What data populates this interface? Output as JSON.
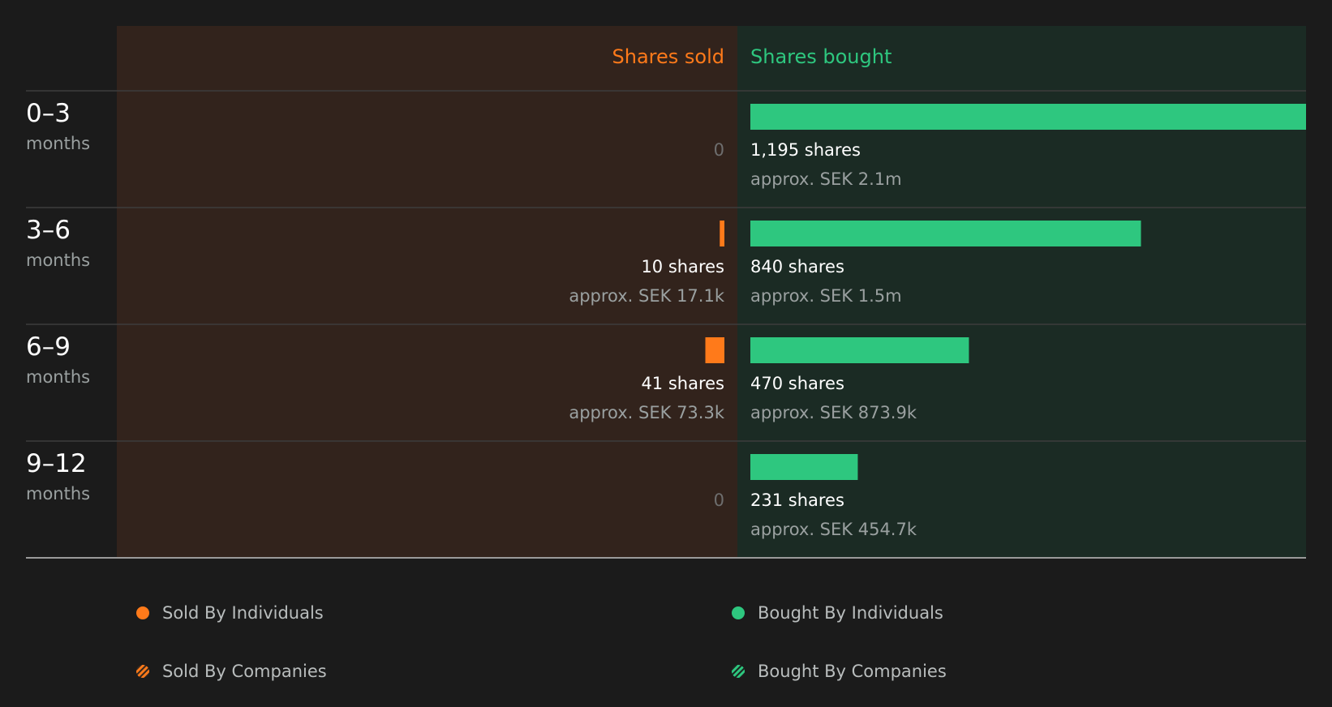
{
  "colors": {
    "page_bg": "#1b1b1b",
    "sold_panel_bg": "#32231c",
    "bought_panel_bg": "#1b2b24",
    "sold": "#ff7a1a",
    "bought": "#2ec77f",
    "muted_text": "#9aa0a0",
    "zero_text": "#6e6e6e",
    "divider": "#3c3c3c"
  },
  "chart_data": {
    "type": "bar",
    "orientation": "horizontal-diverging",
    "header_sold": "Shares sold",
    "header_bought": "Shares bought",
    "categories": [
      {
        "label": "0–3",
        "unit": "months"
      },
      {
        "label": "3–6",
        "unit": "months"
      },
      {
        "label": "6–9",
        "unit": "months"
      },
      {
        "label": "9–12",
        "unit": "months"
      }
    ],
    "x_range_shares": [
      0,
      1195
    ],
    "series": [
      {
        "name": "Shares sold",
        "values": [
          0,
          10,
          41,
          0
        ],
        "value_labels": [
          "0",
          "10 shares",
          "41 shares",
          "0"
        ],
        "approx_labels": [
          "",
          "approx. SEK 17.1k",
          "approx. SEK 73.3k",
          ""
        ]
      },
      {
        "name": "Shares bought",
        "values": [
          1195,
          840,
          470,
          231
        ],
        "value_labels": [
          "1,195 shares",
          "840 shares",
          "470 shares",
          "231 shares"
        ],
        "approx_labels": [
          "approx. SEK 2.1m",
          "approx. SEK 1.5m",
          "approx. SEK 873.9k",
          "approx. SEK 454.7k"
        ]
      }
    ]
  },
  "legend": {
    "sold_individuals": "Sold By Individuals",
    "bought_individuals": "Bought By Individuals",
    "sold_companies": "Sold By Companies",
    "bought_companies": "Bought By Companies"
  }
}
